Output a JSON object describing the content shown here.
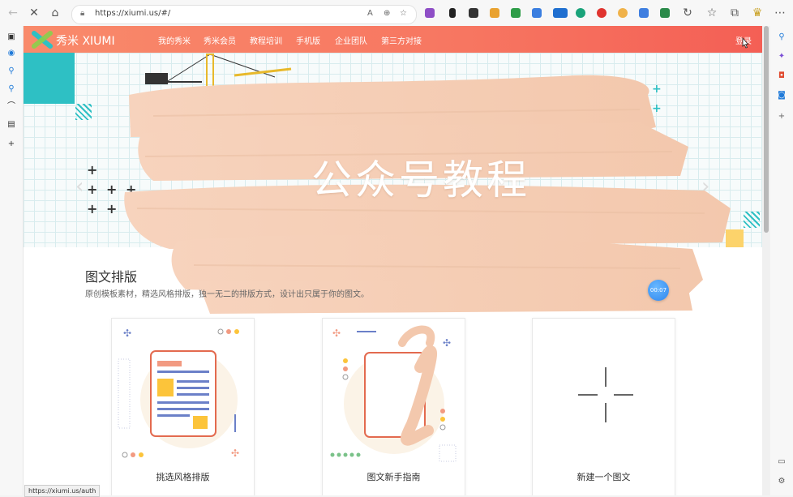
{
  "browser": {
    "url": "https://xiumi.us/#/",
    "status_url": "https://xiumi.us/auth"
  },
  "site": {
    "brand": "秀米 XIUMI",
    "nav": [
      "我的秀米",
      "秀米会员",
      "教程培训",
      "手机版",
      "企业团队",
      "第三方对接"
    ],
    "login": "登录"
  },
  "hero": {
    "title": "公众号教程"
  },
  "section": {
    "title": "图文排版",
    "description": "原创模板素材，精选风格排版，独一无二的排版方式，设计出只属于你的图文。"
  },
  "video_timer": "00:07",
  "cards": [
    {
      "label": "挑选风格排版"
    },
    {
      "label": "图文新手指南"
    },
    {
      "label": "新建一个图文"
    }
  ],
  "colors": {
    "header_gradient_start": "#f98a6b",
    "header_gradient_end": "#f45f55",
    "accent_teal": "#2ec0c4",
    "accent_yellow": "#fcd36b",
    "brush_paint": "#f5cdb3"
  }
}
